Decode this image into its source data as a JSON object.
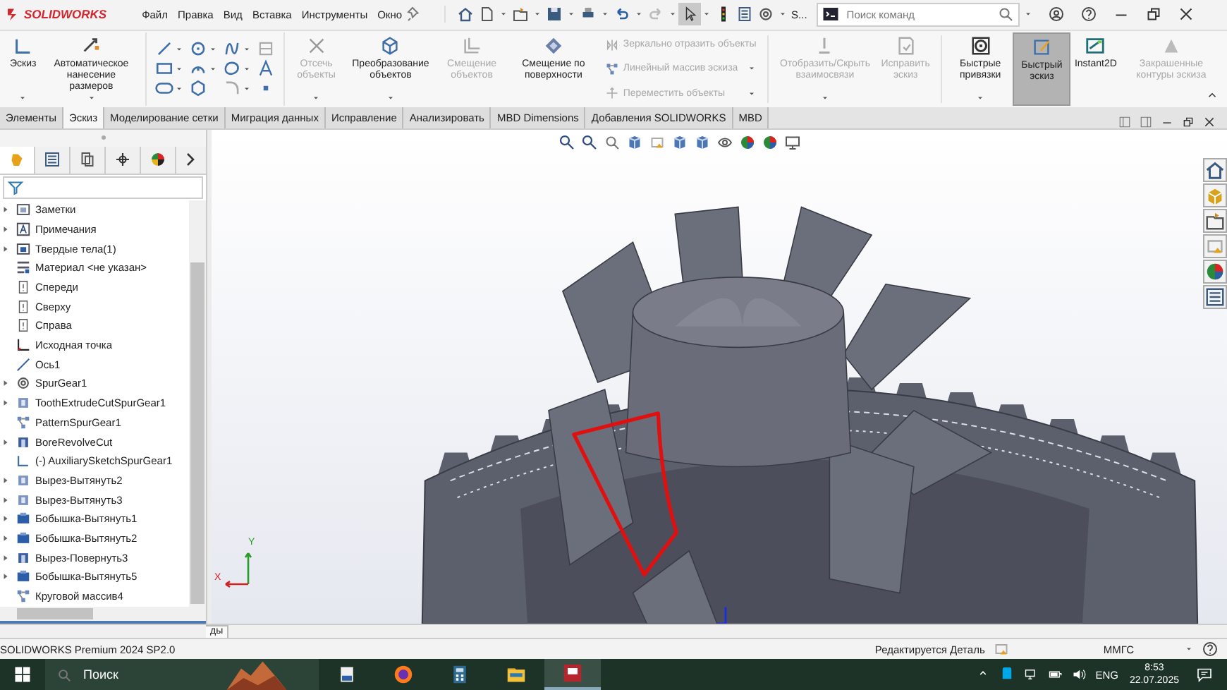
{
  "title_bar": {
    "app_name": "SOLIDWORKS",
    "menu": [
      "Файл",
      "Правка",
      "Вид",
      "Вставка",
      "Инструменты",
      "Окно"
    ],
    "truncated_label": "S...",
    "search": {
      "placeholder": "Поиск команд"
    }
  },
  "ribbon": {
    "items": [
      {
        "kind": "large",
        "label": "Эскиз",
        "disabled": false,
        "pressed": false,
        "caret": true
      },
      {
        "kind": "large",
        "label": "Автоматическое нанесение размеров",
        "disabled": false,
        "pressed": false,
        "caret": true
      },
      {
        "kind": "tools"
      },
      {
        "kind": "large",
        "label": "Отсечь объекты",
        "disabled": true,
        "pressed": false,
        "caret": true
      },
      {
        "kind": "large",
        "label": "Преобразование объектов",
        "disabled": false,
        "pressed": false,
        "caret": true
      },
      {
        "kind": "large",
        "label": "Смещение объектов",
        "disabled": true,
        "pressed": false,
        "caret": false
      },
      {
        "kind": "large",
        "label": "Смещение по поверхности",
        "disabled": false,
        "pressed": false,
        "caret": false
      },
      {
        "kind": "stack",
        "entries": [
          {
            "label": "Зеркально отразить объекты",
            "disabled": true,
            "caret": false
          },
          {
            "label": "Линейный массив эскиза",
            "disabled": true,
            "caret": true
          },
          {
            "label": "Переместить объекты",
            "disabled": true,
            "caret": true
          }
        ]
      },
      {
        "kind": "large",
        "label": "Отобразить/Скрыть взаимосвязи",
        "disabled": true,
        "pressed": false,
        "caret": true
      },
      {
        "kind": "large",
        "label": "Исправить эскиз",
        "disabled": true,
        "pressed": false,
        "caret": false
      },
      {
        "kind": "large",
        "label": "Быстрые привязки",
        "disabled": false,
        "pressed": false,
        "caret": true
      },
      {
        "kind": "large",
        "label": "Быстрый эскиз",
        "disabled": false,
        "pressed": true,
        "caret": false
      },
      {
        "kind": "large",
        "label": "Instant2D",
        "disabled": false,
        "pressed": false,
        "caret": false
      },
      {
        "kind": "large",
        "label": "Закрашенные контуры эскиза",
        "disabled": true,
        "pressed": false,
        "caret": false
      }
    ]
  },
  "tabs": [
    {
      "label": "Элементы",
      "selected": false
    },
    {
      "label": "Эскиз",
      "selected": true
    },
    {
      "label": "Моделирование сетки",
      "selected": false
    },
    {
      "label": "Миграция данных",
      "selected": false
    },
    {
      "label": "Исправление",
      "selected": false
    },
    {
      "label": "Анализировать",
      "selected": false
    },
    {
      "label": "MBD Dimensions",
      "selected": false
    },
    {
      "label": "Добавления SOLIDWORKS",
      "selected": false
    },
    {
      "label": "MBD",
      "selected": false
    }
  ],
  "panel_tabs": [
    {
      "selected": true
    },
    {
      "selected": false
    },
    {
      "selected": false
    },
    {
      "selected": false
    },
    {
      "selected": false
    }
  ],
  "tree": [
    {
      "label": "Заметки",
      "collapsed": true
    },
    {
      "label": "Примечания",
      "collapsed": true
    },
    {
      "label": "Твердые тела(1)",
      "collapsed": true
    },
    {
      "label": "Материал <не указан>",
      "collapsed": false
    },
    {
      "label": "Спереди",
      "collapsed": false
    },
    {
      "label": "Сверху",
      "collapsed": false
    },
    {
      "label": "Справа",
      "collapsed": false
    },
    {
      "label": "Исходная точка",
      "collapsed": false
    },
    {
      "label": "Ось1",
      "collapsed": false
    },
    {
      "label": "SpurGear1",
      "collapsed": true
    },
    {
      "label": "ToothExtrudeCutSpurGear1",
      "collapsed": true
    },
    {
      "label": "PatternSpurGear1",
      "collapsed": false
    },
    {
      "label": "BoreRevolveCut",
      "collapsed": true
    },
    {
      "label": "(-) AuxiliarySketchSpurGear1",
      "collapsed": false
    },
    {
      "label": "Вырез-Вытянуть2",
      "collapsed": true
    },
    {
      "label": "Вырез-Вытянуть3",
      "collapsed": true
    },
    {
      "label": "Бобышка-Вытянуть1",
      "collapsed": true
    },
    {
      "label": "Бобышка-Вытянуть2",
      "collapsed": true
    },
    {
      "label": "Вырез-Повернуть3",
      "collapsed": true
    },
    {
      "label": "Бобышка-Вытянуть5",
      "collapsed": true
    },
    {
      "label": "Круговой массив4",
      "collapsed": false
    }
  ],
  "triad": {
    "x_label": "X",
    "y_label": "Y"
  },
  "cut_tab_text": "ды",
  "status_bar": {
    "product": "SOLIDWORKS Premium 2024 SP2.0",
    "state": "Редактируется Деталь",
    "units": "ММГС"
  },
  "taskbar": {
    "search": {
      "placeholder": "Поиск"
    },
    "apps": [
      {
        "selected": false
      },
      {
        "selected": false
      },
      {
        "selected": false
      },
      {
        "selected": false
      },
      {
        "selected": true
      }
    ],
    "language": "ENG",
    "time": "8:53",
    "date": "22.07.2025"
  }
}
